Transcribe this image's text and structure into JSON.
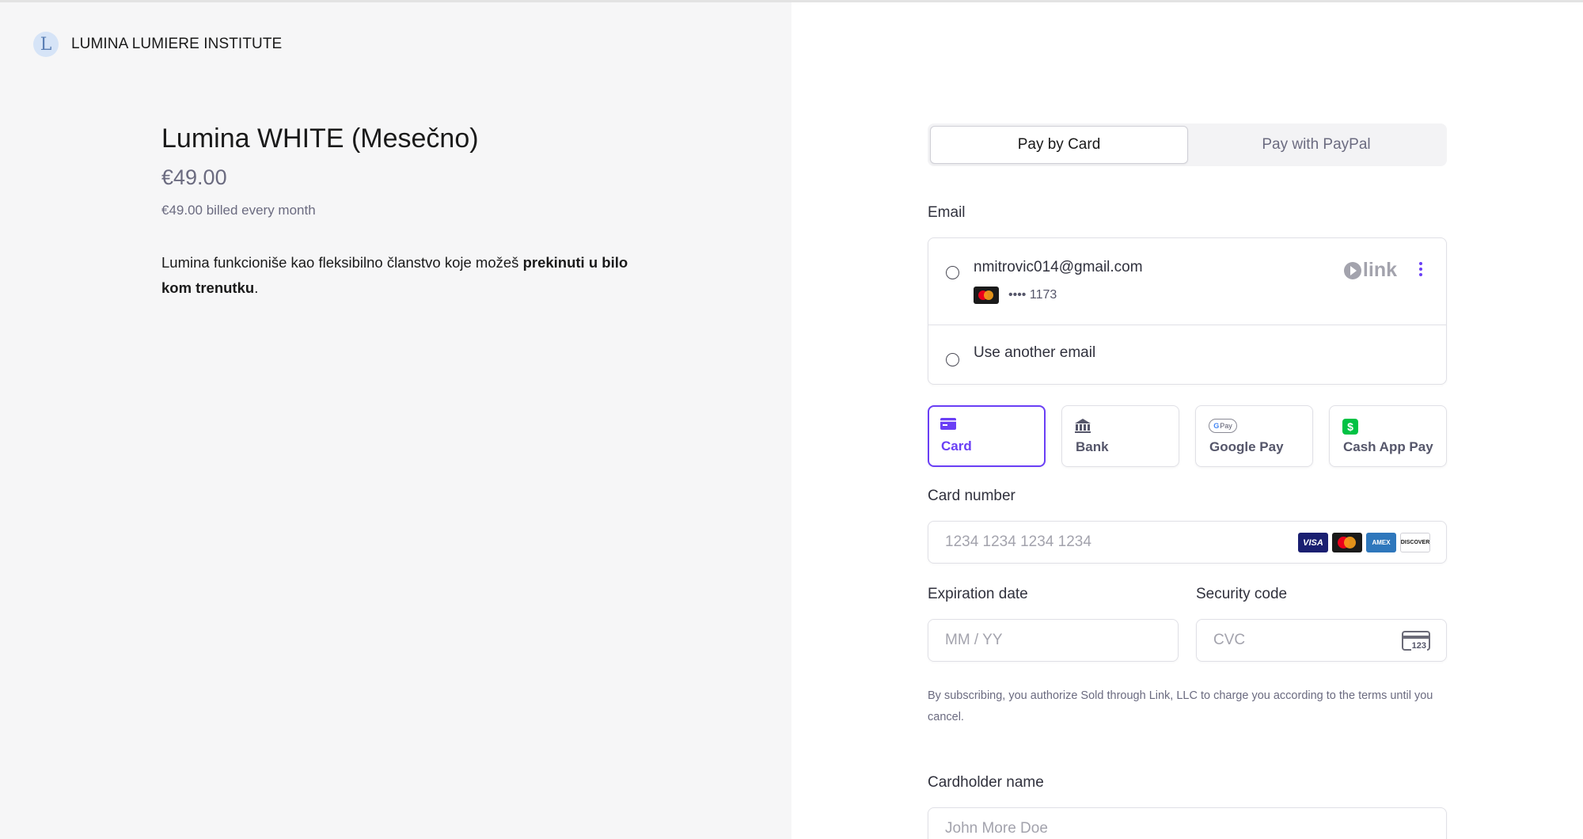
{
  "brand": {
    "logo_letter": "L",
    "name": "LUMINA LUMIERE INSTITUTE"
  },
  "product": {
    "title": "Lumina WHITE (Mesečno)",
    "price": "€49.00",
    "billing": "€49.00 billed every month",
    "description_prefix": "Lumina funkcioniše kao fleksibilno članstvo koje možeš ",
    "description_bold": "prekinuti u bilo kom trenutku",
    "description_suffix": "."
  },
  "pay_tabs": [
    {
      "label": "Pay by Card",
      "active": true
    },
    {
      "label": "Pay with PayPal",
      "active": false
    }
  ],
  "email": {
    "label": "Email",
    "saved_email": "nmitrovic014@gmail.com",
    "saved_card": "•••• 1173",
    "link_logo": "link",
    "use_another": "Use another email"
  },
  "methods": [
    {
      "label": "Card",
      "icon": "card-icon",
      "active": true
    },
    {
      "label": "Bank",
      "icon": "bank-icon",
      "active": false
    },
    {
      "label": "Google Pay",
      "icon": "google-pay-icon",
      "active": false
    },
    {
      "label": "Cash App Pay",
      "icon": "cash-app-icon",
      "active": false
    }
  ],
  "card": {
    "number_label": "Card number",
    "number_placeholder": "1234 1234 1234 1234",
    "brand_visa": "VISA",
    "brand_amex": "AMEX",
    "brand_discover": "DISCOVER",
    "expiry_label": "Expiration date",
    "expiry_placeholder": "MM / YY",
    "cvc_label": "Security code",
    "cvc_placeholder": "CVC",
    "cvc_icon_text": "123"
  },
  "terms": "By subscribing, you authorize Sold through Link, LLC to charge you according to the terms until you cancel.",
  "holder": {
    "label": "Cardholder name",
    "placeholder": "John More Doe"
  },
  "colors": {
    "accent": "#6a3ff5",
    "left_bg": "#f6f6f7",
    "muted": "#6b6b80"
  }
}
